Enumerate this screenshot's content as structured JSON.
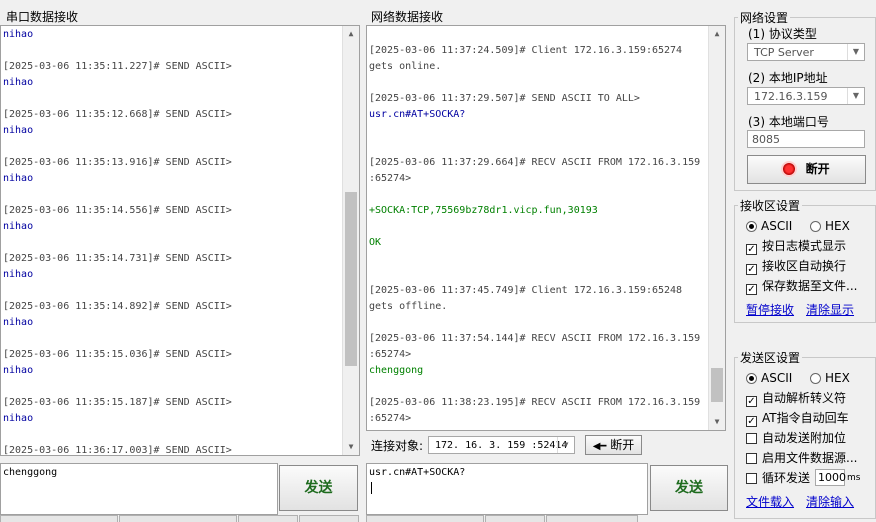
{
  "serial": {
    "title": "串口数据接收",
    "first_line": "nihao",
    "entries": [
      {
        "header": "[2025-03-06 11:35:11.227]# SEND ASCII>",
        "body": "nihao"
      },
      {
        "header": "[2025-03-06 11:35:12.668]# SEND ASCII>",
        "body": "nihao"
      },
      {
        "header": "[2025-03-06 11:35:13.916]# SEND ASCII>",
        "body": "nihao"
      },
      {
        "header": "[2025-03-06 11:35:14.556]# SEND ASCII>",
        "body": "nihao"
      },
      {
        "header": "[2025-03-06 11:35:14.731]# SEND ASCII>",
        "body": "nihao"
      },
      {
        "header": "[2025-03-06 11:35:14.892]# SEND ASCII>",
        "body": "nihao"
      },
      {
        "header": "[2025-03-06 11:35:15.036]# SEND ASCII>",
        "body": "nihao"
      },
      {
        "header": "[2025-03-06 11:35:15.187]# SEND ASCII>",
        "body": "nihao"
      },
      {
        "header": "[2025-03-06 11:36:17.003]# SEND ASCII>",
        "body": ""
      }
    ],
    "send_text": "chenggong",
    "send_label": "发送"
  },
  "network": {
    "title": "网络数据接收",
    "lines": [
      {
        "text": "[2025-03-06 11:37:24.509]# Client 172.16.3.159:65274",
        "cls": "hdr"
      },
      {
        "text": "gets online.",
        "cls": "hdr"
      },
      {
        "text": "",
        "cls": "hdr"
      },
      {
        "text": "[2025-03-06 11:37:29.507]# SEND ASCII TO ALL>",
        "cls": "hdr"
      },
      {
        "text": "usr.cn#AT+SOCKA?",
        "cls": "blue"
      },
      {
        "text": "",
        "cls": "hdr"
      },
      {
        "text": "",
        "cls": "hdr"
      },
      {
        "text": "[2025-03-06 11:37:29.664]# RECV ASCII FROM 172.16.3.159",
        "cls": "hdr"
      },
      {
        "text": ":65274>",
        "cls": "hdr"
      },
      {
        "text": "",
        "cls": "hdr"
      },
      {
        "text": "+SOCKA:TCP,75569bz78dr1.vicp.fun,30193",
        "cls": "green"
      },
      {
        "text": "",
        "cls": "hdr"
      },
      {
        "text": "OK",
        "cls": "green"
      },
      {
        "text": "",
        "cls": "hdr"
      },
      {
        "text": "",
        "cls": "hdr"
      },
      {
        "text": "[2025-03-06 11:37:45.749]# Client 172.16.3.159:65248",
        "cls": "hdr"
      },
      {
        "text": "gets offline.",
        "cls": "hdr"
      },
      {
        "text": "",
        "cls": "hdr"
      },
      {
        "text": "[2025-03-06 11:37:54.144]# RECV ASCII FROM 172.16.3.159",
        "cls": "hdr"
      },
      {
        "text": ":65274>",
        "cls": "hdr"
      },
      {
        "text": "chenggong",
        "cls": "green"
      },
      {
        "text": "",
        "cls": "hdr"
      },
      {
        "text": "[2025-03-06 11:38:23.195]# RECV ASCII FROM 172.16.3.159",
        "cls": "hdr"
      },
      {
        "text": ":65274>",
        "cls": "hdr"
      }
    ],
    "connect_label": "连接对象:",
    "connect_value": "172. 16. 3. 159 :52414",
    "disconnect_label": "断开",
    "send_text": "usr.cn#AT+SOCKA?",
    "send_label": "发送"
  },
  "net_settings": {
    "title": "网络设置",
    "protocol_label": "(1) 协议类型",
    "protocol_value": "TCP Server",
    "ip_label": "(2) 本地IP地址",
    "ip_value": "172.16.3.159",
    "port_label": "(3) 本地端口号",
    "port_value": "8085",
    "open_button": "断开"
  },
  "recv_settings": {
    "title": "接收区设置",
    "radio_ascii": "ASCII",
    "radio_hex": "HEX",
    "checks": [
      {
        "label": "按日志模式显示",
        "checked": true
      },
      {
        "label": "接收区自动换行",
        "checked": true
      },
      {
        "label": "保存数据至文件...",
        "checked": true
      }
    ],
    "link_pause": "暂停接收",
    "link_clear": "清除显示"
  },
  "send_settings": {
    "title": "发送区设置",
    "radio_ascii": "ASCII",
    "radio_hex": "HEX",
    "checks": [
      {
        "label": "自动解析转义符",
        "checked": true
      },
      {
        "label": "AT指令自动回车",
        "checked": true
      },
      {
        "label": "自动发送附加位",
        "checked": false
      },
      {
        "label": "启用文件数据源...",
        "checked": false
      }
    ],
    "loop_label": "循环发送",
    "loop_value": "1000",
    "loop_unit": "ms",
    "link_load": "文件载入",
    "link_clear": "清除输入"
  }
}
